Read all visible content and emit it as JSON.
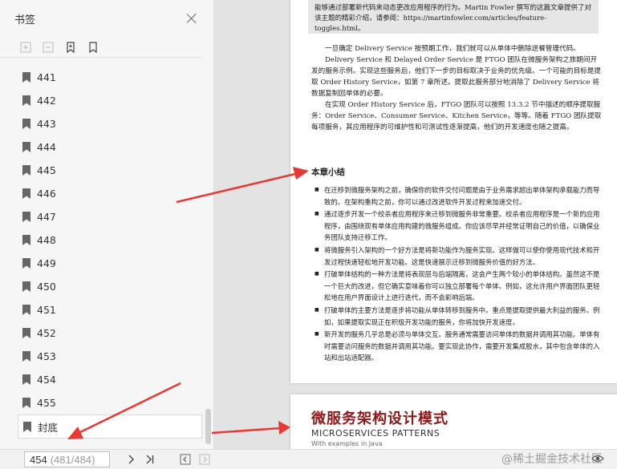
{
  "sidebar": {
    "title": "书签",
    "bookmarks": [
      {
        "label": "441"
      },
      {
        "label": "442"
      },
      {
        "label": "443"
      },
      {
        "label": "444"
      },
      {
        "label": "445"
      },
      {
        "label": "446"
      },
      {
        "label": "447"
      },
      {
        "label": "448"
      },
      {
        "label": "449"
      },
      {
        "label": "450"
      },
      {
        "label": "451"
      },
      {
        "label": "452"
      },
      {
        "label": "453"
      },
      {
        "label": "454"
      },
      {
        "label": "455"
      },
      {
        "label": "封底"
      }
    ]
  },
  "document": {
    "quote_text": "能够通过部署新代码来动态更改应用程序的行为。Martin Fowler 撰写的这篇文章提供了对该主题的精彩介绍，请参阅：https://martinfowler.com/articles/feature-toggles.html。",
    "paragraphs": [
      "一旦确定 Delivery Service 按预期工作，我们就可以从单体中删除送餐管理代码。",
      "Delivery Service 和 Delayed Order Service 是 FTGO 团队在微服务架构之旅期间开发的服务示例。实现这些服务后，他们下一步的目标取决于业务的优先级。一个可能的目标是提取 Order History Service，如第 7 章所述。提取此服务部分地消除了 Delivery Service 将数据复制回单体的必要。",
      "在实现 Order History Service 后，FTGO 团队可以按照 13.3.2 节中描述的顺序提取服务：Order Service、Consumer Service、Kitchen Service，等等。随着 FTGO 团队提取每项服务，其应用程序的可维护性和可测试性逐渐提高，他们的开发速度也随之提高。"
    ],
    "section_title": "本章小结",
    "bullets": [
      "在迁移到微服务架构之前，确保你的软件交付问题是由于业务需求超出单体架构承载能力而导致的。在架构重构之前，你可以通过改进软件开发过程来加速交付。",
      "通过逐步开发一个绞杀者应用程序来迁移到微服务非常重要。绞杀者应用程序是一个新的应用程序，由围绕现有单体应用构建的微服务组成。你应该尽早并经常证明自己的价值，以确保业务团队支持迁移工作。",
      "将微服务引入架构的一个好方法是将新功能作为服务实现。这样做可以使你使用现代技术和开发过程快速轻松地开发功能。这是快速展示迁移到微服务价值的好方法。",
      "打破单体结构的一种方法是将表现层与后端隔离，这会产生两个较小的单体结构。虽然这不是一个巨大的改进，但它确实意味着你可以独立部署每个单体。例如，这允许用户界面团队更轻松地在用户界面设计上进行迭代，而不会影响后端。",
      "打破单体的主要方法是逐步将功能从单体转移到服务中。重点是提取提供最大利益的服务。例如，如果提取实现正在积极开发功能的服务，你将加快开发速度。",
      "新开发的服务几乎总是必须与单体交互。服务通常需要访问单体的数据并调用其功能。单体有时需要访问服务的数据并调用其功能。要实现此协作，需要开发集成胶水，其中包含单体的入站和出站适配器。"
    ],
    "next_page_title": "微服务架构设计模式",
    "next_page_subtitle": "MICROSERVICES PATTERNS",
    "next_page_subtitle2": "With examples in Java"
  },
  "bottom_bar": {
    "current_page": "454",
    "page_info": "(481/484)",
    "next_icon": "chevron-right-icon",
    "last_icon": "skip-to-end-icon",
    "watermark": "@稀土掘金技术社区"
  },
  "colors": {
    "arrow": "#e53935",
    "cover_title": "#8a1a1a"
  }
}
